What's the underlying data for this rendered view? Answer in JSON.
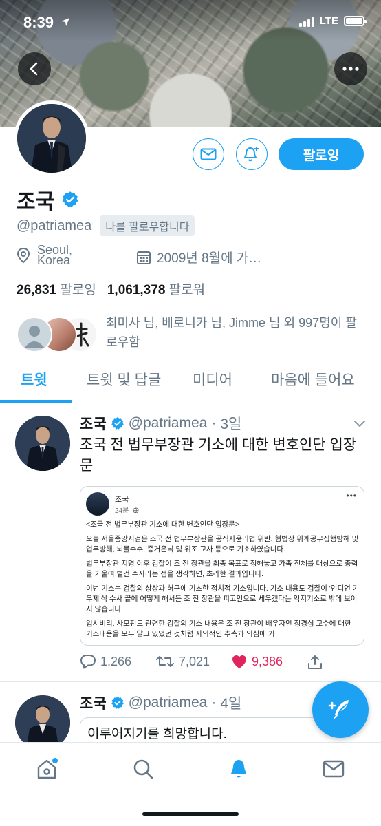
{
  "status_bar": {
    "time": "8:39",
    "network": "LTE"
  },
  "profile": {
    "display_name": "조국",
    "handle": "@patriamea",
    "follows_you": "나를 팔로우합니다",
    "location": "Seoul, Korea",
    "joined": "2009년 8월에 가…",
    "following_count": "26,831",
    "following_label": "팔로잉",
    "followers_count": "1,061,378",
    "followers_label": "팔로워",
    "mutual_followers": "최미사 님, 베로니카 님, Jimme 님 외 997명이 팔로우함",
    "following_button": "팔로잉"
  },
  "tabs": [
    {
      "label": "트윗",
      "active": true
    },
    {
      "label": "트윗 및 답글",
      "active": false
    },
    {
      "label": "미디어",
      "active": false
    },
    {
      "label": "마음에 들어요",
      "active": false
    }
  ],
  "tweets": [
    {
      "name": "조국",
      "handle": "@patriamea",
      "time": "3일",
      "text": "조국 전 법무부장관 기소에 대한 변호인단 입장문",
      "embed": {
        "author": "조국",
        "time": "24분",
        "paragraphs": [
          "<조국 전 법무부장관 기소에 대한 변호인단 입장문>",
          "오늘 서울중앙지검은 조국 전 법무부장관을 공직자윤리법 위반, 형법상 위계공무집행방해 및 업무방해, 뇌물수수, 증거은닉 및 위조 교사 등으로 기소하였습니다.",
          "법무부장관 지명 이후 검찰이 조 전 장관을 최종 목표로 정해놓고 가족 전체를 대상으로 총력을 기울여 별건 수사라는 점을 생각하면, 초라한 결과입니다.",
          "이번 기소는 검찰의 상상과 허구에 기초한 정치적 기소입니다. 기소 내용도 검찰이 '인디언 기우제'식 수사 끝에 어떻게 해서든 조 전 장관을 피고인으로 세우겠다는 억지기소로 밖에 보이지 않습니다.",
          "입시비리, 사모펀드 관련한 검찰의 기소 내용은 조 전 장관이 배우자인 정경심 교수에 대한 기소내용을 모두 알고 있었던 것처럼 자의적인 추측과 의심에 기"
        ]
      },
      "replies": "1,266",
      "retweets": "7,021",
      "likes": "9,386"
    },
    {
      "name": "조국",
      "handle": "@patriamea",
      "time": "4일",
      "quote_text": "이루어지기를 희망합니다."
    }
  ],
  "colors": {
    "accent": "#1da1f2",
    "like": "#e0245e",
    "secondary_text": "#657786"
  },
  "icons": [
    "back-arrow-icon",
    "more-icon",
    "mail-icon",
    "bell-plus-icon",
    "verified-badge-icon",
    "location-icon",
    "calendar-icon",
    "reply-icon",
    "retweet-icon",
    "heart-icon",
    "share-icon",
    "compose-icon",
    "home-icon",
    "search-icon",
    "notifications-icon",
    "messages-icon"
  ]
}
